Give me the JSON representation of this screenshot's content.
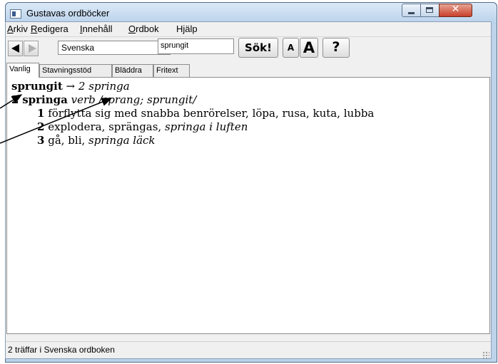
{
  "window": {
    "title": "Gustavas ordböcker",
    "close_glyph": "✕"
  },
  "menu": {
    "items": [
      {
        "mnemonic": "A",
        "rest": "rkiv"
      },
      {
        "mnemonic": "R",
        "rest": "edigera"
      },
      {
        "mnemonic": "I",
        "rest": "nnehåll"
      },
      {
        "mnemonic": "O",
        "rest": "rdbok"
      },
      {
        "mnemonic": "",
        "rest": "Hjälp"
      }
    ]
  },
  "toolbar": {
    "language_selected": "Svenska",
    "search_value": "sprungit",
    "search_button": "Sök!",
    "font_small": "A",
    "font_large": "A",
    "help": "?"
  },
  "tabs": [
    "Vanlig",
    "Stavningsstöd",
    "Bläddra",
    "Fritext"
  ],
  "entry": {
    "redirect_word": "sprungit",
    "redirect_arrow": "→",
    "redirect_target": "2 springa",
    "headword_number": "2",
    "headword": "springa",
    "grammar": "verb /sprang; sprungit/",
    "senses": [
      {
        "num": "1",
        "text": "förflytta sig med snabba benrörelser, löpa, rusa, kuta, lubba",
        "example": ""
      },
      {
        "num": "2",
        "text": "explodera, sprängas, ",
        "example": "springa i luften"
      },
      {
        "num": "3",
        "text": "gå, bli, ",
        "example": "springa läck"
      }
    ]
  },
  "status": {
    "text": "2 träffar i Svenska ordboken"
  },
  "colors": {
    "title_bar": "#bcd3ea",
    "close_button": "#c7402b",
    "annotation_arrows": "#000000"
  }
}
